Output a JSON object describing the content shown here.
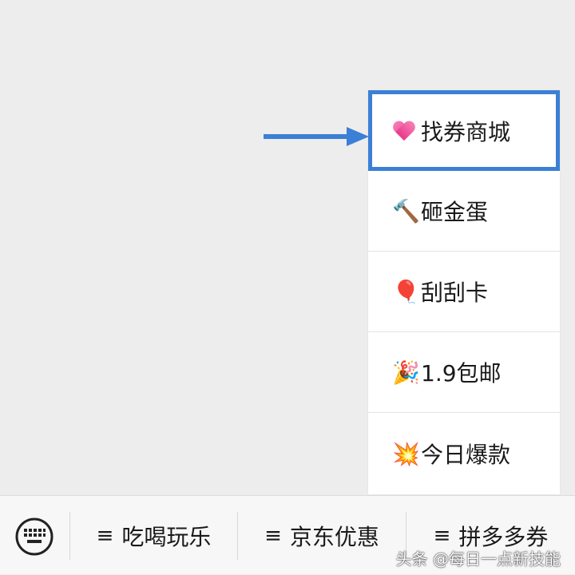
{
  "submenu": {
    "items": [
      {
        "icon": "sparkling-heart-icon",
        "label": "找券商城",
        "highlighted": true
      },
      {
        "icon": "hammer-icon",
        "emoji": "🔨",
        "label": "砸金蛋"
      },
      {
        "icon": "balloon-icon",
        "emoji": "🎈",
        "label": "刮刮卡"
      },
      {
        "icon": "party-popper-icon",
        "emoji": "🎉",
        "label": "1.9包邮"
      },
      {
        "icon": "collision-icon",
        "emoji": "💥",
        "label": "今日爆款"
      }
    ]
  },
  "menubar": {
    "keyboard_icon": "keyboard-icon",
    "menu_symbol": "≡",
    "buttons": [
      {
        "label": "吃喝玩乐"
      },
      {
        "label": "京东优惠"
      },
      {
        "label": "拼多多券"
      }
    ]
  },
  "watermark": "头条 @每日一点新技能",
  "colors": {
    "highlight_border": "#3b7fd6",
    "arrow": "#3b7fd6",
    "background": "#ededed"
  }
}
